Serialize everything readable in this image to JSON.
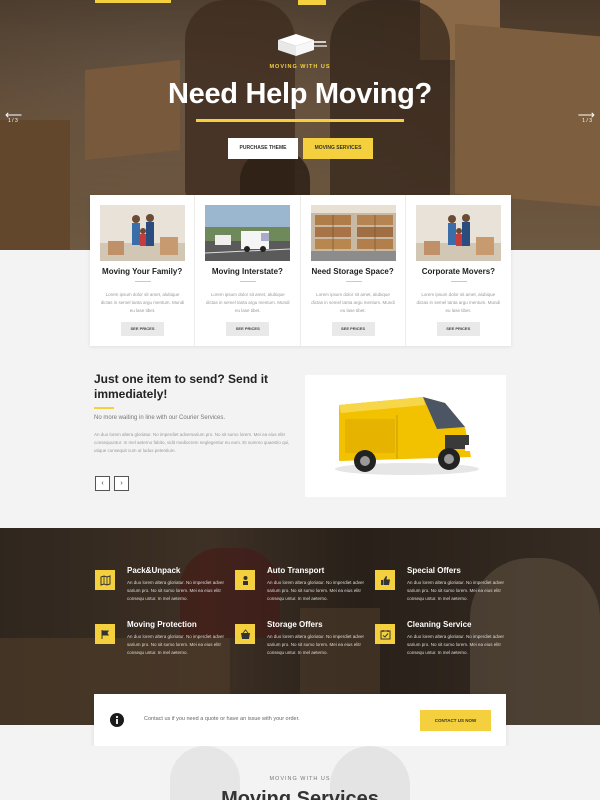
{
  "hero": {
    "eyebrow": "MOVING WITH US",
    "title": "Need Help Moving?",
    "purchase_label": "PURCHASE THEME",
    "services_label": "MOVING SERVICES",
    "slide_left": "1 / 3",
    "slide_right": "1 / 3",
    "arrow_left": "⟵",
    "arrow_right": "⟶"
  },
  "cards": [
    {
      "title": "Moving Your Family?",
      "text": "Lorem ipsum dolor sit amet, alubique dictas in semel tanta argu mentum. Mundi eu lase tibet.",
      "button": "SEE PRICES",
      "image": "family-with-boxes"
    },
    {
      "title": "Moving Interstate?",
      "text": "Lorem ipsum dolor sit amet, alubique dictas in semel tanta argu mentum. Mundi eu lase tibet.",
      "button": "SEE PRICES",
      "image": "vans-on-highway"
    },
    {
      "title": "Need Storage Space?",
      "text": "Lorem ipsum dolor sit amet, alubique dictas in semel tanta argu mentum. Mundi eu lase tibet.",
      "button": "SEE PRICES",
      "image": "warehouse-shelves"
    },
    {
      "title": "Corporate Movers?",
      "text": "Lorem ipsum dolor sit amet, alubique dictas in semel tanta argu mentum. Mundi eu lase tibet.",
      "button": "SEE PRICES",
      "image": "family-with-boxes"
    }
  ],
  "section2": {
    "title": "Just one item to send? Send it immediately!",
    "subtitle": "No more waiting in line with our Courier Services.",
    "body": "An duo lorem altera gloriatur. No imperdiet adversarium pro. No sit sumo lorem. Mei ea eius elitr consequuntur. In mel aeterno fabito, vidit mediocrem neglegentur eu eum. Et summo quaestio qui, utique consequit cum ut ludus petentium.",
    "prev_label": "‹",
    "next_label": "›"
  },
  "services": [
    {
      "title": "Pack&Unpack",
      "text": "An duo lorem altera gloriatur. No imperdiet adver sarium pro. No sit sumo lorem. Mei ea eius elitr consequ untur. In mel aeterno.",
      "icon": "map-icon"
    },
    {
      "title": "Auto Transport",
      "text": "An duo lorem altera gloriatur. No imperdiet adver sarium pro. No sit sumo lorem. Mei ea eius elitr consequ untur. In mel aeterno.",
      "icon": "person-icon"
    },
    {
      "title": "Special Offers",
      "text": "An duo lorem altera gloriatur. No imperdiet adver sarium pro. No sit sumo lorem. Mei ea eius elitr consequ untur. In mel aeterno.",
      "icon": "thumbs-up-icon"
    },
    {
      "title": "Moving Protection",
      "text": "An duo lorem altera gloriatur. No imperdiet adver sarium pro. No sit sumo lorem. Mei ea eius elitr consequ untur. In mel aeterno.",
      "icon": "flag-icon"
    },
    {
      "title": "Storage Offers",
      "text": "An duo lorem altera gloriatur. No imperdiet adver sarium pro. No sit sumo lorem. Mei ea eius elitr consequ untur. In mel aeterno.",
      "icon": "basket-icon"
    },
    {
      "title": "Cleaning Service",
      "text": "An duo lorem altera gloriatur. No imperdiet adver sarium pro. No sit sumo lorem. Mei ea eius elitr consequ untur. In mel aeterno.",
      "icon": "calendar-check-icon"
    }
  ],
  "contact": {
    "text": "Contact us if you need a quote or have an issue with your order.",
    "button": "CONTACT US NOW",
    "icon": "info-icon"
  },
  "bottom": {
    "eyebrow": "MOVING WITH US",
    "title": "Moving Services"
  },
  "colors": {
    "accent": "#f4d03f",
    "text_dark": "#222222",
    "text_muted": "#999999"
  }
}
